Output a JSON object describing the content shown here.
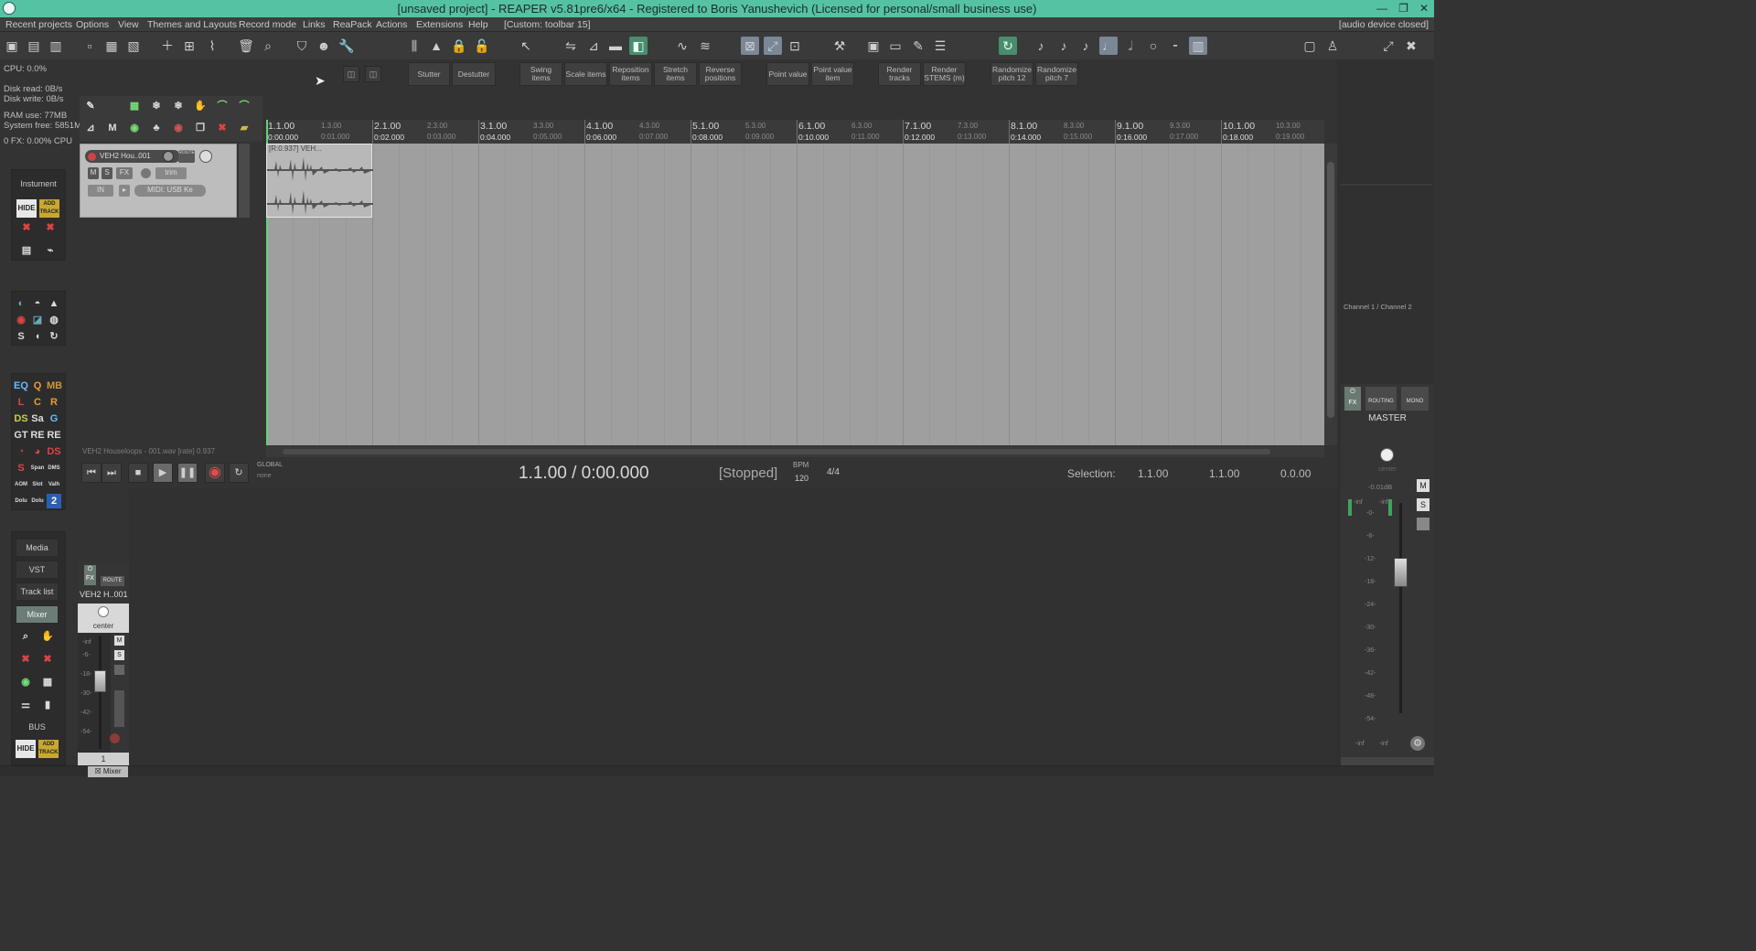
{
  "window": {
    "title": "[unsaved project] - REAPER v5.81pre6/x64 - Registered to Boris Yanushevich (Licensed for personal/small business use)",
    "controls": [
      "—",
      "❐",
      "✕"
    ]
  },
  "menu": {
    "items": [
      "Recent projects",
      "Options",
      "View",
      "Themes and Layouts",
      "Record mode",
      "Links",
      "ReaPack",
      "Actions",
      "Extensions",
      "Help",
      "[Custom: toolbar 15]"
    ],
    "status_right": "[audio device closed]"
  },
  "toolbar2": {
    "buttons": [
      "Stutter",
      "Destutter",
      "Swing items",
      "Scale items",
      "Reposition items",
      "Stretch items",
      "Reverse positions",
      "Point value",
      "Point value item",
      "Render tracks",
      "Render STEMS (m)",
      "Randomize pitch 12",
      "Randomize pitch 7"
    ]
  },
  "stats": {
    "cpu": "CPU: 0.0%",
    "disk_read": "Disk read: 0B/s",
    "disk_write": "Disk write: 0B/s",
    "ram": "RAM use: 77MB",
    "system_free": "System free: 5851M",
    "fx_cpu": "0 FX: 0.00% CPU"
  },
  "sidebar": {
    "instrument_label": "Instument",
    "hide": "HIDE",
    "add_track": "ADD TRACK",
    "media": "Media",
    "vst": "VST",
    "track_list": "Track list",
    "mixer": "Mixer",
    "bus": "BUS"
  },
  "track": {
    "name": "VEH2 Hou..001",
    "mute": "M",
    "solo": "S",
    "fx": "FX",
    "trim": "trim",
    "in": "IN",
    "midi": "MIDI: USB Ke",
    "route": "ROUTE",
    "number": "1"
  },
  "item": {
    "header": "[R:0.937] VEH..."
  },
  "ruler": {
    "measures": [
      "1.1.00",
      "2.1.00",
      "3.1.00",
      "4.1.00",
      "5.1.00",
      "6.1.00",
      "7.1.00",
      "8.1.00",
      "9.1.00",
      "10.1.00"
    ],
    "times": [
      "0:00.000",
      "0:02.000",
      "0:04.000",
      "0:06.000",
      "0:08.000",
      "0:10.000",
      "0:12.000",
      "0:14.000",
      "0:16.000",
      "0:18.000"
    ],
    "half_measures": [
      "1.3.00",
      "2.3.00",
      "3.3.00",
      "4.3.00",
      "5.3.00",
      "6.3.00",
      "7.3.00",
      "8.3.00",
      "9.3.00",
      "10.3.00"
    ],
    "half_times": [
      "0:01.000",
      "0:03.000",
      "0:05.000",
      "0:07.000",
      "0:09.000",
      "0:11.000",
      "0:13.000",
      "0:15.000",
      "0:17.000",
      "0:19.000"
    ]
  },
  "status_line": "VEH2 Houseloops - 001.wav [rate] 0.937",
  "transport": {
    "position": "1.1.00 / 0:00.000",
    "state": "[Stopped]",
    "bpm_label": "BPM",
    "bpm": "120",
    "time_sig": "4/4",
    "selection_label": "Selection:",
    "sel_start": "1.1.00",
    "sel_end": "1.1.00",
    "sel_len": "0.0.00",
    "global": "GLOBAL",
    "global_sub": "none"
  },
  "mixer": {
    "track_name": "VEH2 H..001",
    "pan": "center",
    "route": "ROUTE",
    "scale": [
      "-inf",
      "-6-",
      "-18-",
      "-30-",
      "-42-",
      "-54-"
    ],
    "tab": "Mixer"
  },
  "master": {
    "label": "MASTER",
    "channel": "Channel 1 / Channel 2",
    "routing": "ROUTING",
    "mono": "MONO",
    "fx": "FX",
    "db": "-0.01dB",
    "pan": "center",
    "scale": [
      "-inf",
      "-0-",
      "-6-",
      "-12-",
      "-18-",
      "-24-",
      "-30-",
      "-36-",
      "-42-",
      "-48-",
      "-54-"
    ],
    "bottom_left": "-inf",
    "bottom_right": "-inf"
  }
}
